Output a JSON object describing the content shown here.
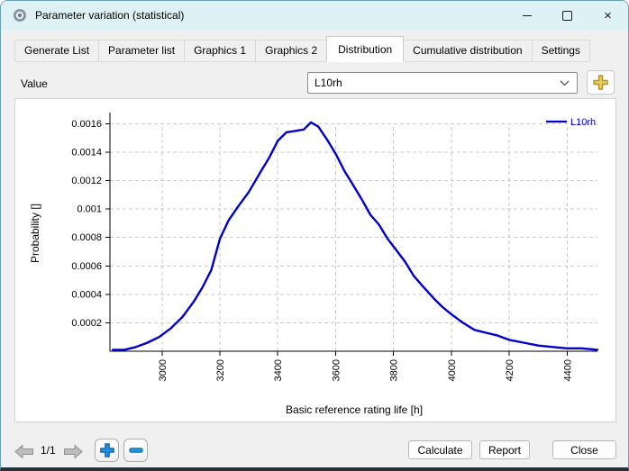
{
  "window": {
    "title": "Parameter variation (statistical)",
    "close_glyph": "×"
  },
  "tabs": [
    {
      "label": "Generate List",
      "active": false
    },
    {
      "label": "Parameter list",
      "active": false
    },
    {
      "label": "Graphics 1",
      "active": false
    },
    {
      "label": "Graphics 2",
      "active": false
    },
    {
      "label": "Distribution",
      "active": true
    },
    {
      "label": "Cumulative distribution",
      "active": false
    },
    {
      "label": "Settings",
      "active": false
    }
  ],
  "value_row": {
    "label": "Value",
    "selected": "L10rh"
  },
  "chart_data": {
    "type": "line",
    "title": "",
    "xlabel": "Basic reference rating life [h]",
    "ylabel": "Probability []",
    "xlim": [
      2820,
      4505
    ],
    "ylim": [
      0,
      0.00166
    ],
    "x_ticks": [
      3000,
      3200,
      3400,
      3600,
      3800,
      4000,
      4200,
      4400
    ],
    "y_ticks": [
      0.0002,
      0.0004,
      0.0006,
      0.0008,
      0.001,
      0.0012,
      0.0014,
      0.0016
    ],
    "grid": true,
    "legend_position": "top-right",
    "legend_text_color": "#0000e0",
    "series": [
      {
        "name": "L10rh",
        "color": "#0000cd",
        "x": [
          2830,
          2870,
          2910,
          2950,
          2990,
          3030,
          3070,
          3110,
          3140,
          3170,
          3200,
          3230,
          3260,
          3300,
          3340,
          3370,
          3400,
          3430,
          3460,
          3490,
          3515,
          3540,
          3570,
          3600,
          3630,
          3660,
          3690,
          3720,
          3750,
          3780,
          3810,
          3840,
          3870,
          3900,
          3940,
          3970,
          4000,
          4040,
          4080,
          4120,
          4160,
          4200,
          4250,
          4300,
          4350,
          4400,
          4450,
          4505
        ],
        "y": [
          1e-05,
          1e-05,
          3e-05,
          6e-05,
          0.0001,
          0.00016,
          0.00024,
          0.00035,
          0.00045,
          0.00057,
          0.00079,
          0.00092,
          0.00101,
          0.00112,
          0.00126,
          0.00136,
          0.00148,
          0.00154,
          0.00155,
          0.00156,
          0.00161,
          0.00158,
          0.00149,
          0.00139,
          0.00127,
          0.00117,
          0.00107,
          0.00096,
          0.00089,
          0.00079,
          0.00071,
          0.00063,
          0.00053,
          0.00046,
          0.00037,
          0.00031,
          0.00026,
          0.0002,
          0.00015,
          0.00013,
          0.00011,
          8e-05,
          6e-05,
          4e-05,
          3e-05,
          2e-05,
          2e-05,
          1e-05
        ]
      }
    ]
  },
  "footer": {
    "page_indicator": "1/1",
    "calculate_label": "Calculate",
    "report_label": "Report",
    "close_label": "Close"
  },
  "icons": {
    "app_icon": "bearing-logo",
    "dropdown_chevron": "chevron-down",
    "add_value": "gold-plus",
    "prev_page": "gray-arrow-left",
    "next_page": "gray-arrow-right",
    "zoom_in": "blue-plus",
    "zoom_out": "blue-minus"
  },
  "colors": {
    "titlebar": "#def1f5",
    "curve": "#0000cd",
    "gold_icon": "#e7c757",
    "blue_icon": "#1f8fdc"
  }
}
